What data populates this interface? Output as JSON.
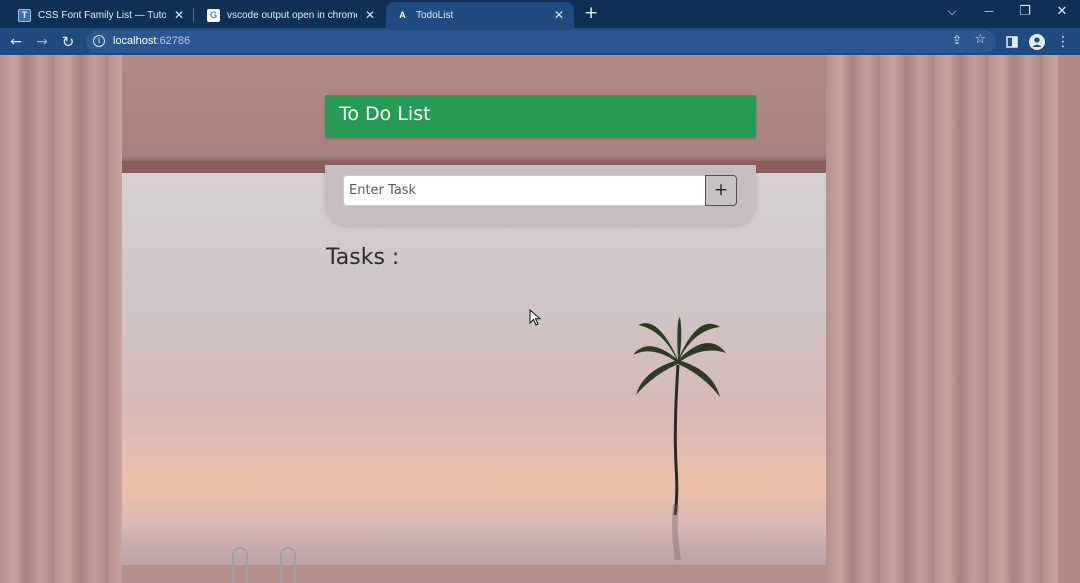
{
  "browser": {
    "tabs": [
      {
        "title": "CSS Font Family List — TutorialB",
        "favicon": "tutorialbrain-icon"
      },
      {
        "title": "vscode output open in chrome -",
        "favicon": "google-icon"
      },
      {
        "title": "TodoList",
        "favicon": "angular-icon",
        "active": true
      }
    ],
    "close_glyph": "✕",
    "new_tab_glyph": "+",
    "window_controls": {
      "dropdown": "⌵",
      "minimize": "—",
      "restore": "❐",
      "close": "✕"
    },
    "address": {
      "host": "localhost",
      "port": ":62786"
    },
    "nav_glyphs": {
      "back": "←",
      "forward": "→",
      "reload": "↻",
      "info": "i",
      "share": "⇪",
      "star": "☆",
      "menu": "⋮"
    }
  },
  "app": {
    "header_title": "To Do List",
    "input_placeholder": "Enter Task",
    "add_button_label": "+",
    "tasks_heading": "Tasks :"
  },
  "colors": {
    "header_green": "#259b55",
    "chrome_dark": "#0f2f57",
    "chrome_toolbar": "#1f4a82"
  }
}
